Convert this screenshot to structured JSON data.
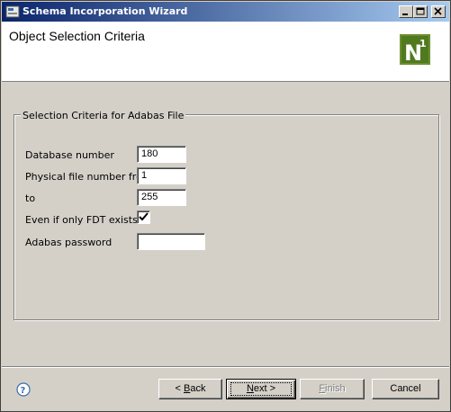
{
  "window": {
    "title": "Schema Incorporation Wizard",
    "controls": {
      "minimize": "_",
      "maximize": "□",
      "close": "✕"
    }
  },
  "header": {
    "title": "Object Selection Criteria",
    "logo": {
      "text": "N",
      "superscript": "1"
    }
  },
  "group": {
    "label": "Selection Criteria for Adabas File",
    "fields": {
      "database_number": {
        "label": "Database number",
        "value": "180"
      },
      "file_from": {
        "label": "Physical file number from",
        "value": "1"
      },
      "file_to": {
        "label": "to",
        "value": "255"
      },
      "fdt_only": {
        "label": "Even if only FDT exists",
        "checked": true
      },
      "password": {
        "label": "Adabas password",
        "value": ""
      }
    }
  },
  "buttons": {
    "back": {
      "prefix": "< ",
      "mnemonic": "B",
      "rest": "ack"
    },
    "next": {
      "mnemonic": "N",
      "rest": "ext >"
    },
    "finish": {
      "mnemonic": "F",
      "rest": "inish"
    },
    "cancel": "Cancel"
  },
  "icons": {
    "help": "help-icon",
    "app": "wizard-app-icon",
    "check": "checkmark-icon"
  }
}
